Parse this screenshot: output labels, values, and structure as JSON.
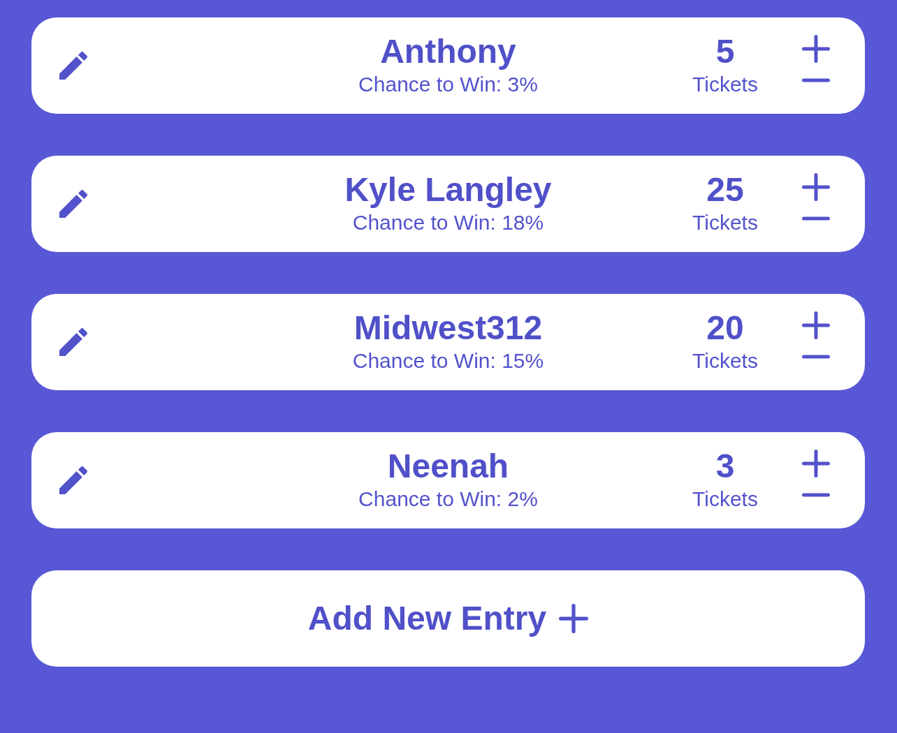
{
  "entries": [
    {
      "name": "Anthony",
      "chance": "Chance to Win: 3%",
      "tickets": "5",
      "tickets_label": "Tickets"
    },
    {
      "name": "Kyle Langley",
      "chance": "Chance to Win: 18%",
      "tickets": "25",
      "tickets_label": "Tickets"
    },
    {
      "name": "Midwest312",
      "chance": "Chance to Win: 15%",
      "tickets": "20",
      "tickets_label": "Tickets"
    },
    {
      "name": "Neenah",
      "chance": "Chance to Win: 2%",
      "tickets": "3",
      "tickets_label": "Tickets"
    }
  ],
  "add_button": {
    "label": "Add New Entry"
  }
}
